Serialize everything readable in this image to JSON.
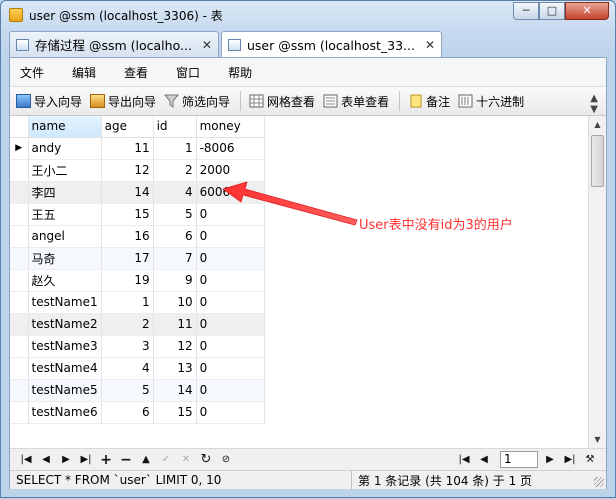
{
  "window": {
    "title": "user @ssm (localhost_3306) - 表",
    "controls": {
      "minimize": "─",
      "maximize": "□",
      "close": "✕"
    }
  },
  "tabs": [
    {
      "label": "存储过程 @ssm (localho...",
      "close": "✕",
      "active": false
    },
    {
      "label": "user @ssm (localhost_33...",
      "close": "✕",
      "active": true
    }
  ],
  "menu": [
    "文件",
    "编辑",
    "查看",
    "窗口",
    "帮助"
  ],
  "toolbar": {
    "import": "导入向导",
    "export": "导出向导",
    "filter": "筛选向导",
    "grid_view": "网格查看",
    "form_view": "表单查看",
    "note": "备注",
    "hex": "十六进制"
  },
  "table": {
    "columns": [
      "name",
      "age",
      "id",
      "money"
    ],
    "rows": [
      {
        "name": "andy",
        "age": "11",
        "id": "1",
        "money": "-8006"
      },
      {
        "name": "王小二",
        "age": "12",
        "id": "2",
        "money": "2000"
      },
      {
        "name": "李四",
        "age": "14",
        "id": "4",
        "money": "6006"
      },
      {
        "name": "王五",
        "age": "15",
        "id": "5",
        "money": "0"
      },
      {
        "name": "angel",
        "age": "16",
        "id": "6",
        "money": "0"
      },
      {
        "name": "马奇",
        "age": "17",
        "id": "7",
        "money": "0"
      },
      {
        "name": "赵久",
        "age": "19",
        "id": "9",
        "money": "0"
      },
      {
        "name": "testName1",
        "age": "1",
        "id": "10",
        "money": "0"
      },
      {
        "name": "testName2",
        "age": "2",
        "id": "11",
        "money": "0"
      },
      {
        "name": "testName3",
        "age": "3",
        "id": "12",
        "money": "0"
      },
      {
        "name": "testName4",
        "age": "4",
        "id": "13",
        "money": "0"
      },
      {
        "name": "testName5",
        "age": "5",
        "id": "14",
        "money": "0"
      },
      {
        "name": "testName6",
        "age": "6",
        "id": "15",
        "money": "0"
      }
    ]
  },
  "annotation": {
    "text": "User表中没有id为3的用户",
    "color": "#ff3333"
  },
  "navigation": {
    "current_page": "1"
  },
  "status": {
    "sql": "SELECT * FROM `user` LIMIT 0, 10",
    "records": "第 1 条记录 (共 104 条) 于 1 页"
  }
}
